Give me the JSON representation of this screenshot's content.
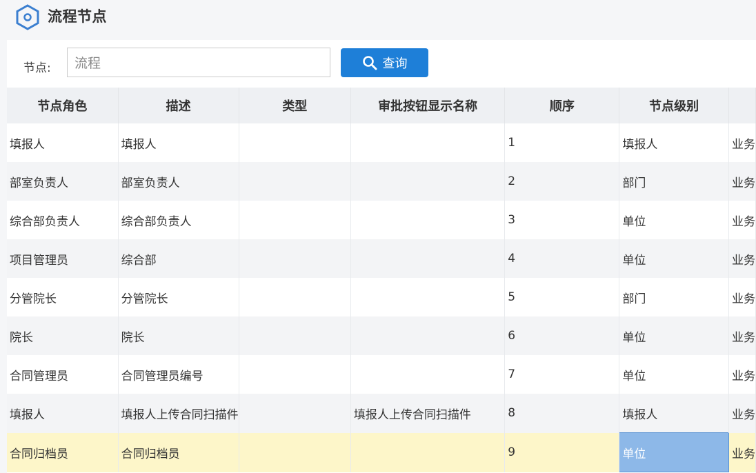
{
  "header": {
    "title": "流程节点",
    "icon": "hexagon-node-icon"
  },
  "search": {
    "label": "节点:",
    "value": "流程",
    "button_label": "查询",
    "button_icon": "search-icon"
  },
  "colors": {
    "accent": "#1e7fd8",
    "selected_row": "#fdf6c9",
    "active_cell": "#8db8e8"
  },
  "table": {
    "columns": [
      "节点角色",
      "描述",
      "类型",
      "审批按钮显示名称",
      "顺序",
      "节点级别",
      ""
    ],
    "rows": [
      [
        "填报人",
        "填报人",
        "",
        "",
        "1",
        "填报人",
        "业务"
      ],
      [
        "部室负责人",
        "部室负责人",
        "",
        "",
        "2",
        "部门",
        "业务"
      ],
      [
        "综合部负责人",
        "综合部负责人",
        "",
        "",
        "3",
        "单位",
        "业务"
      ],
      [
        "项目管理员",
        "综合部",
        "",
        "",
        "4",
        "单位",
        "业务"
      ],
      [
        "分管院长",
        "分管院长",
        "",
        "",
        "5",
        "部门",
        "业务"
      ],
      [
        "院长",
        "院长",
        "",
        "",
        "6",
        "单位",
        "业务"
      ],
      [
        "合同管理员",
        "合同管理员编号",
        "",
        "",
        "7",
        "单位",
        "业务"
      ],
      [
        "填报人",
        "填报人上传合同扫描件",
        "",
        "填报人上传合同扫描件",
        "8",
        "填报人",
        "业务"
      ],
      [
        "合同归档员",
        "合同归档员",
        "",
        "",
        "9",
        "单位",
        "业务"
      ]
    ],
    "selected_row_index": 8
  }
}
